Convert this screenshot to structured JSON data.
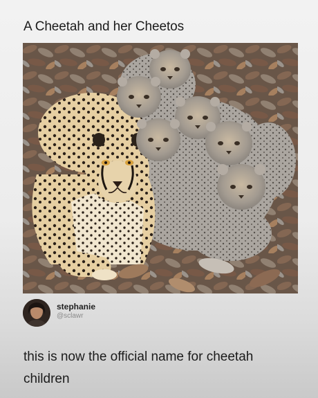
{
  "post": {
    "title": "A Cheetah and her Cheetos",
    "image_subject": "cheetah-with-cubs",
    "author": {
      "display_name": "stephanie",
      "username": "@sclawr"
    },
    "body_text": "this is now the official name for cheetah children"
  },
  "colors": {
    "background_top": "#f2f2f2",
    "background_bottom": "#c9c9c9",
    "text": "#1b1b1b",
    "username": "#8a8a8a",
    "leaves": "#8b6b55",
    "cheetah_fur": "#e2c99a",
    "cub_fur": "#a9a5a0"
  }
}
